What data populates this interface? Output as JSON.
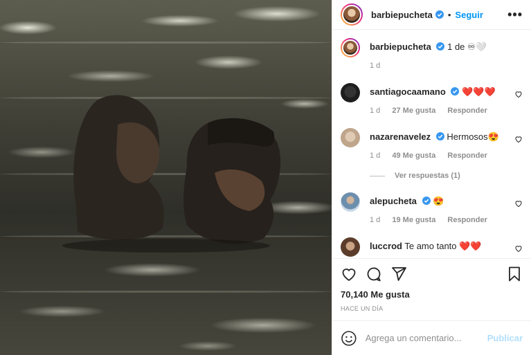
{
  "header": {
    "username": "barbiepucheta",
    "follow_label": "Seguir",
    "separator": "•",
    "more_label": "•••"
  },
  "caption": {
    "username": "barbiepucheta",
    "text": "1 de ♾🤍",
    "time": "1 d"
  },
  "comments": [
    {
      "username": "santiagocaamano",
      "text": "❤️❤️❤️",
      "time": "1 d",
      "likes": "27 Me gusta",
      "reply": "Responder"
    },
    {
      "username": "nazarenavelez",
      "text": "Hermosos😍",
      "time": "1 d",
      "likes": "49 Me gusta",
      "reply": "Responder",
      "view_replies": "Ver respuestas (1)"
    },
    {
      "username": "alepucheta",
      "text": "😍",
      "time": "1 d",
      "likes": "19 Me gusta",
      "reply": "Responder"
    },
    {
      "username": "luccrod",
      "text": "Te amo tanto ❤️❤️"
    }
  ],
  "stats": {
    "likes": "70,140 Me gusta",
    "time_ago": "HACE UN DÍA"
  },
  "add_comment": {
    "placeholder": "Agrega un comentario...",
    "publish_label": "Publicar"
  },
  "colors": {
    "accent": "#0095f6",
    "verified": "#3897f0",
    "heart_red": "#ed4956",
    "muted": "#8e8e8e",
    "publish_disabled": "#b2dffc"
  },
  "icons": [
    "verified-badge-icon",
    "heart-icon",
    "comment-icon",
    "share-icon",
    "bookmark-icon",
    "emoji-icon",
    "more-options-icon"
  ]
}
